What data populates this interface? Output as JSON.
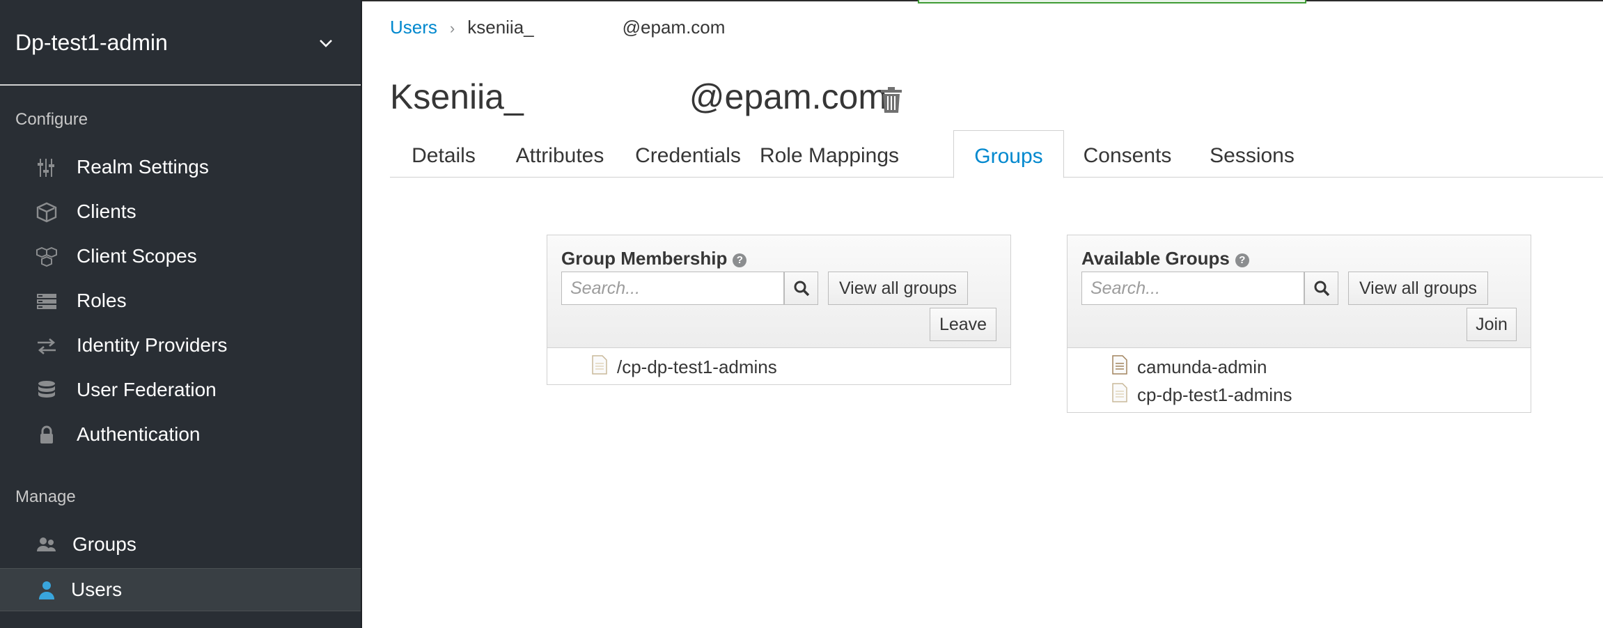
{
  "sidebar": {
    "realm": "Dp-test1-admin",
    "configure_label": "Configure",
    "manage_label": "Manage",
    "configure_items": [
      {
        "label": "Realm Settings",
        "icon": "sliders-icon"
      },
      {
        "label": "Clients",
        "icon": "cube-icon"
      },
      {
        "label": "Client Scopes",
        "icon": "cubes-icon"
      },
      {
        "label": "Roles",
        "icon": "list-icon"
      },
      {
        "label": "Identity Providers",
        "icon": "exchange-icon"
      },
      {
        "label": "User Federation",
        "icon": "database-icon"
      },
      {
        "label": "Authentication",
        "icon": "lock-icon"
      }
    ],
    "manage_items": [
      {
        "label": "Groups",
        "icon": "users-icon"
      },
      {
        "label": "Users",
        "icon": "user-icon",
        "active": true
      }
    ]
  },
  "breadcrumb": {
    "root": "Users",
    "current_start": "kseniia_",
    "current_end": "@epam.com"
  },
  "title": {
    "first": "Kseniia_",
    "second": "@epam.com"
  },
  "tabs": [
    {
      "label": "Details"
    },
    {
      "label": "Attributes"
    },
    {
      "label": "Credentials"
    },
    {
      "label": "Role Mappings"
    },
    {
      "label": "Groups",
      "active": true
    },
    {
      "label": "Consents"
    },
    {
      "label": "Sessions"
    }
  ],
  "membership": {
    "title": "Group Membership",
    "help": "?",
    "search_placeholder": "Search...",
    "view_all": "View all groups",
    "action": "Leave",
    "items": [
      "/cp-dp-test1-admins"
    ]
  },
  "available": {
    "title": "Available Groups",
    "help": "?",
    "search_placeholder": "Search...",
    "view_all": "View all groups",
    "action": "Join",
    "items": [
      "camunda-admin",
      "cp-dp-test1-admins"
    ]
  },
  "colors": {
    "sidebar_bg": "#292e34",
    "link": "#0088ce",
    "active_icon": "#39a5dc"
  }
}
